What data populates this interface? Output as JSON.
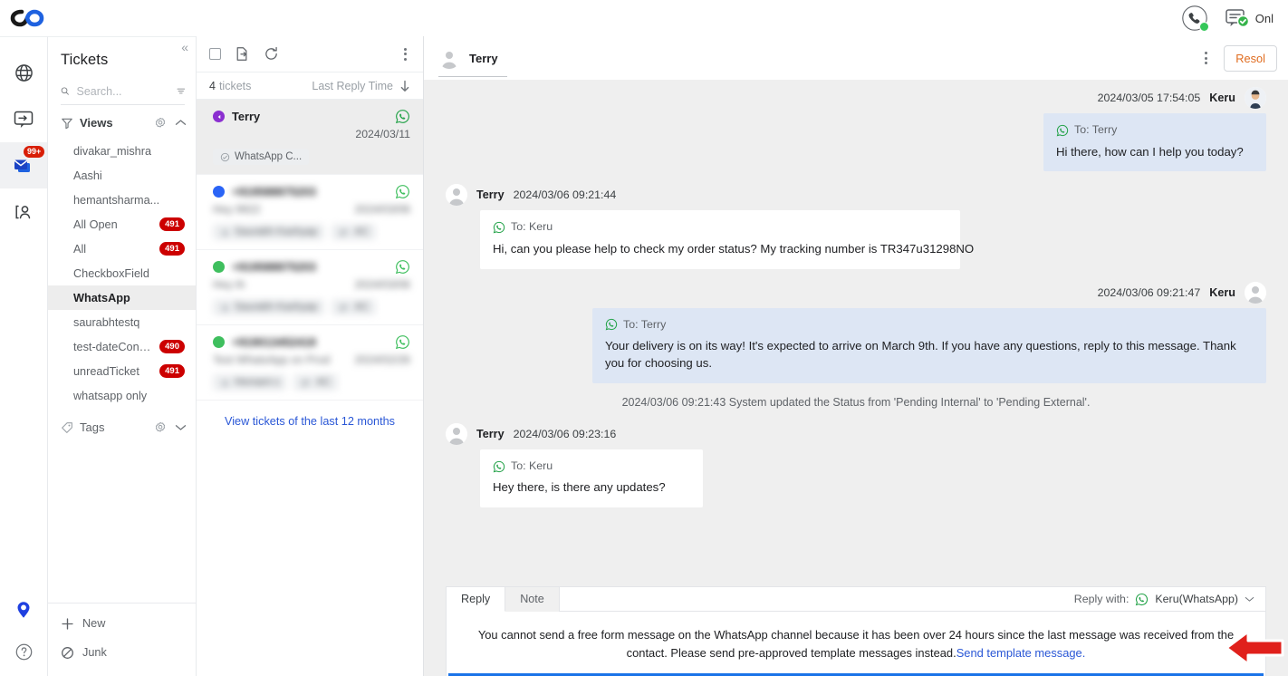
{
  "topbar": {
    "logo_name": "brand-logo",
    "phone_icon": "phone-call-icon",
    "status_icon": "chat-online-icon",
    "status_text": "Onl"
  },
  "rail": {
    "items": [
      {
        "name": "globe-icon",
        "label": "Globe",
        "badge": "",
        "active": false
      },
      {
        "name": "chat-bubble-icon",
        "label": "Chat",
        "badge": "",
        "active": false
      },
      {
        "name": "mail-icon",
        "label": "Tickets",
        "badge": "99+",
        "active": true
      },
      {
        "name": "contacts-icon",
        "label": "Contacts",
        "badge": "",
        "active": false
      }
    ],
    "bottom_items": [
      {
        "name": "location-pin-icon",
        "label": "Pin"
      },
      {
        "name": "help-circle-icon",
        "label": "Help"
      }
    ]
  },
  "sidebar": {
    "title": "Tickets",
    "collapse_label": "«",
    "search": {
      "placeholder": "Search...",
      "value": ""
    },
    "filter_icon": "filter-lines-icon",
    "views_section": {
      "label": "Views",
      "icon": "funnel-icon",
      "settings_icon": "gear-icon",
      "chevron": "chevron-up-icon"
    },
    "views": [
      {
        "label": "divakar_mishra",
        "count": "",
        "active": false
      },
      {
        "label": "Aashi",
        "count": "",
        "active": false
      },
      {
        "label": "hemantsharma...",
        "count": "",
        "active": false
      },
      {
        "label": "All Open",
        "count": "491",
        "active": false
      },
      {
        "label": "All",
        "count": "491",
        "active": false
      },
      {
        "label": "CheckboxField",
        "count": "",
        "active": false
      },
      {
        "label": "WhatsApp",
        "count": "",
        "active": true
      },
      {
        "label": "saurabhtestq",
        "count": "",
        "active": false
      },
      {
        "label": "test-dateConditi...",
        "count": "490",
        "active": false
      },
      {
        "label": "unreadTicket",
        "count": "491",
        "active": false
      },
      {
        "label": "whatsapp only",
        "count": "",
        "active": false
      }
    ],
    "tags_section": {
      "label": "Tags",
      "icon": "tag-icon",
      "settings_icon": "gear-icon",
      "chevron": "chevron-down-icon"
    },
    "footer": [
      {
        "label": "New",
        "icon": "plus-icon"
      },
      {
        "label": "Junk",
        "icon": "block-icon"
      }
    ]
  },
  "ticket_list": {
    "toolbar": {
      "select_all": "select-all-checkbox",
      "export_icon": "export-icon",
      "refresh_icon": "refresh-icon",
      "more_icon": "more-vertical-icon"
    },
    "count_number": "4",
    "count_label": "tickets",
    "sort_label": "Last Reply Time",
    "sort_direction_icon": "arrow-down-icon",
    "tickets": [
      {
        "name": "Terry",
        "date": "2024/03/11",
        "preview": "",
        "channel_icon": "whatsapp-icon",
        "status_color": "#8b2fd0",
        "active": true,
        "blurred": false,
        "tags": [
          {
            "label": "WhatsApp C...",
            "icon": "ticket-icon"
          }
        ]
      },
      {
        "name": "+919588875203",
        "date": "2024/03/06",
        "preview": "Hey 9922",
        "channel_icon": "whatsapp-icon",
        "status_color": "#2a64f6",
        "active": false,
        "blurred": true,
        "tags": [
          {
            "label": "Saurabh Kashyap",
            "icon": "user-icon"
          },
          {
            "label": "AC",
            "icon": "group-icon"
          }
        ]
      },
      {
        "name": "+919588875203",
        "date": "2024/03/06",
        "preview": "Hey th",
        "channel_icon": "whatsapp-icon",
        "status_color": "#3fbf5e",
        "active": false,
        "blurred": true,
        "tags": [
          {
            "label": "Saurabh Kashyap",
            "icon": "user-icon"
          },
          {
            "label": "AC",
            "icon": "group-icon"
          }
        ]
      },
      {
        "name": "+919013452418",
        "date": "2024/02/26",
        "preview": "Test WhatsApp on Prod",
        "channel_icon": "whatsapp-icon",
        "status_color": "#3fbf5e",
        "active": false,
        "blurred": true,
        "tags": [
          {
            "label": "Hemant s",
            "icon": "user-icon"
          },
          {
            "label": "AC",
            "icon": "group-icon"
          }
        ]
      }
    ],
    "footer_link": "View tickets of the last 12 months"
  },
  "conversation": {
    "contact_name": "Terry",
    "more_icon": "more-vertical-icon",
    "resolve_label": "Resol",
    "messages": [
      {
        "direction": "out",
        "author": "Keru",
        "time": "2024/03/05 17:54:05",
        "to": "To: Terry",
        "channel_icon": "whatsapp-icon",
        "text": "Hi there, how can I help you today?"
      },
      {
        "direction": "in",
        "author": "Terry",
        "time": "2024/03/06 09:21:44",
        "to": "To: Keru",
        "channel_icon": "whatsapp-icon",
        "text": "Hi, can you please help to check my order status? My tracking number is TR347u31298NO"
      },
      {
        "direction": "out",
        "author": "Keru",
        "time": "2024/03/06 09:21:47",
        "to": "To: Terry",
        "channel_icon": "whatsapp-icon",
        "text": "Your delivery is on its way! It's expected to arrive on March 9th. If you have any questions, reply to this message. Thank you for choosing us."
      }
    ],
    "system_line": "2024/03/06 09:21:43 System updated the Status from 'Pending Internal' to 'Pending External'.",
    "last_message": {
      "direction": "in",
      "author": "Terry",
      "time": "2024/03/06 09:23:16",
      "to": "To: Keru",
      "channel_icon": "whatsapp-icon",
      "text": "Hey there, is there any updates?"
    }
  },
  "composer": {
    "tabs": [
      {
        "label": "Reply",
        "active": true
      },
      {
        "label": "Note",
        "active": false
      }
    ],
    "reply_with_label": "Reply with:",
    "reply_with_channel": "Keru(WhatsApp)",
    "reply_with_icon": "whatsapp-icon",
    "chevron_icon": "chevron-down-icon",
    "warning_text": "You cannot send a free form message on the WhatsApp channel because it has been over 24 hours since the last message was received from the contact. Please send pre-approved template messages instead.",
    "warning_link": "Send template message."
  },
  "annotation": {
    "arrow_name": "red-left-arrow-annotation",
    "arrow_color": "#e0201b"
  }
}
